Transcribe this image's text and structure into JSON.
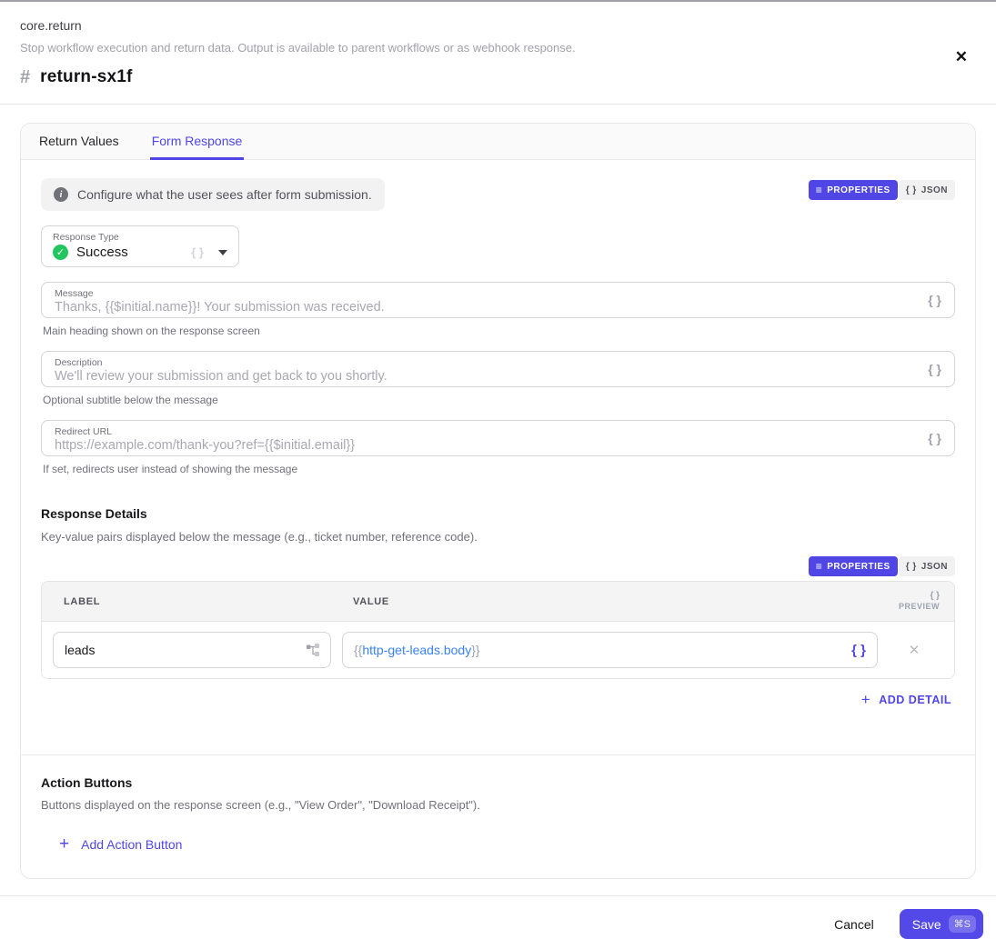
{
  "colors": {
    "accent": "#4f46e5",
    "success_green": "#22c55e",
    "token_blue": "#3b82f6"
  },
  "icons": {
    "close": "✕",
    "hash": "#",
    "info": "i",
    "list": "≡",
    "braces": "{ }",
    "check": "✓",
    "plus": "+",
    "remove": "✕"
  },
  "header": {
    "node_type": "core.return",
    "description": "Stop workflow execution and return data. Output is available to parent workflows or as webhook response.",
    "title": "return-sx1f"
  },
  "tabs": [
    {
      "label": "Return Values",
      "active": false
    },
    {
      "label": "Form Response",
      "active": true
    }
  ],
  "banner": {
    "text": "Configure what the user sees after form submission."
  },
  "view_toggle": {
    "properties_label": "PROPERTIES",
    "json_label": "JSON"
  },
  "response_type": {
    "label": "Response Type",
    "value": "Success"
  },
  "fields": {
    "message": {
      "label": "Message",
      "placeholder": "Thanks, {{$initial.name}}! Your submission was received.",
      "helper": "Main heading shown on the response screen"
    },
    "description": {
      "label": "Description",
      "placeholder": "We'll review your submission and get back to you shortly.",
      "helper": "Optional subtitle below the message"
    },
    "redirect_url": {
      "label": "Redirect URL",
      "placeholder": "https://example.com/thank-you?ref={{$initial.email}}",
      "helper": "If set, redirects user instead of showing the message"
    }
  },
  "details": {
    "heading": "Response Details",
    "description": "Key-value pairs displayed below the message (e.g., ticket number, reference code).",
    "columns": {
      "label": "LABEL",
      "value": "VALUE",
      "preview": "PREVIEW"
    },
    "rows": [
      {
        "label": "leads",
        "value_prefix": "{{",
        "value_token": "http-get-leads.body",
        "value_suffix": "}}"
      }
    ],
    "add_button": "ADD DETAIL"
  },
  "actions": {
    "heading": "Action Buttons",
    "description": "Buttons displayed on the response screen (e.g., \"View Order\", \"Download Receipt\").",
    "add_button": "Add Action Button"
  },
  "footer": {
    "cancel": "Cancel",
    "save": "Save",
    "shortcut": "⌘S"
  }
}
